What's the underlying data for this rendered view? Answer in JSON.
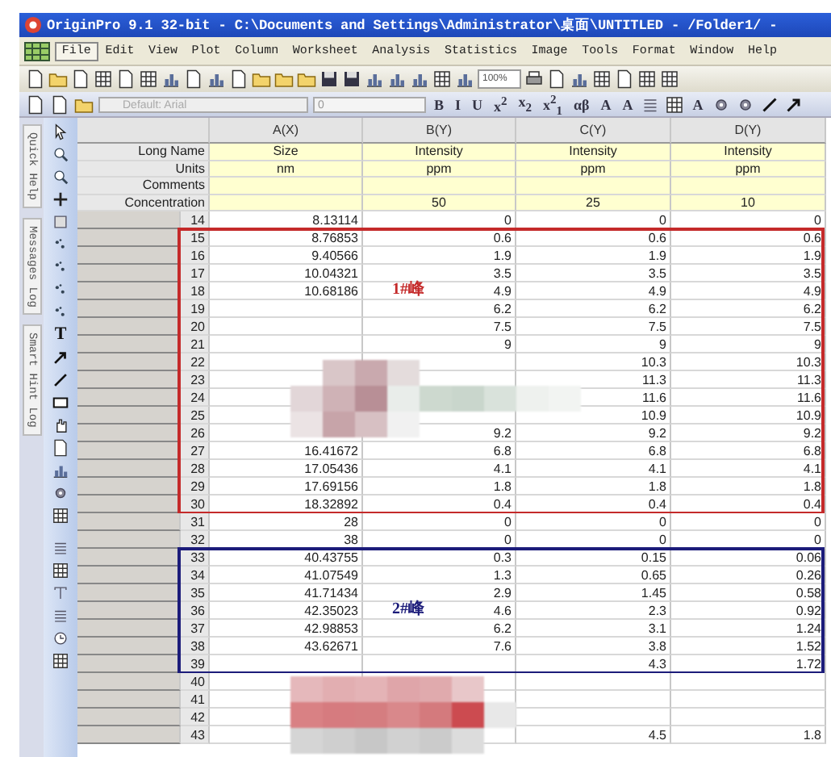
{
  "window": {
    "title": "OriginPro 9.1 32-bit - C:\\Documents and Settings\\Administrator\\桌面\\UNTITLED - /Folder1/ -"
  },
  "menu": [
    {
      "label": "File",
      "selected": true
    },
    {
      "label": "Edit",
      "selected": false
    },
    {
      "label": "View",
      "selected": false
    },
    {
      "label": "Plot",
      "selected": false
    },
    {
      "label": "Column",
      "selected": false
    },
    {
      "label": "Worksheet",
      "selected": false
    },
    {
      "label": "Analysis",
      "selected": false
    },
    {
      "label": "Statistics",
      "selected": false
    },
    {
      "label": "Image",
      "selected": false
    },
    {
      "label": "Tools",
      "selected": false
    },
    {
      "label": "Format",
      "selected": false
    },
    {
      "label": "Window",
      "selected": false
    },
    {
      "label": "Help",
      "selected": false
    }
  ],
  "toolbar": {
    "zoom_value": "100%"
  },
  "format_toolbar": {
    "font_value": "Default: Arial",
    "size_value": "0",
    "buttons": [
      "B",
      "I",
      "U",
      "x$^{2}$",
      "x$_{2}$",
      "x$^{2}$$_{1}$",
      "αβ",
      "A",
      "A"
    ],
    "color_button": "A"
  },
  "side_tabs": [
    "Quick Help",
    "Messages Log",
    "Smart Hint Log"
  ],
  "tools": {
    "text_tool": "T"
  },
  "sheet": {
    "columns": [
      "A(X)",
      "B(Y)",
      "C(Y)",
      "D(Y)"
    ],
    "meta_rows": [
      {
        "label": "Long Name",
        "cells": [
          "Size",
          "Intensity",
          "Intensity",
          "Intensity"
        ]
      },
      {
        "label": "Units",
        "cells": [
          "nm",
          "ppm",
          "ppm",
          "ppm"
        ]
      },
      {
        "label": "Comments",
        "cells": [
          null,
          null,
          null,
          null
        ]
      },
      {
        "label": "Concentration",
        "cells": [
          null,
          "50",
          "25",
          "10"
        ]
      }
    ],
    "row_blocks": [
      {
        "rows": [
          {
            "num": "14",
            "cells": [
              "8.13114",
              "0",
              "0",
              "0"
            ]
          }
        ]
      },
      {
        "label": "1#峰",
        "color": "#c42a2a",
        "rows": [
          {
            "num": "15",
            "cells": [
              "8.76853",
              "0.6",
              "0.6",
              "0.6"
            ]
          },
          {
            "num": "16",
            "cells": [
              "9.40566",
              "1.9",
              "1.9",
              "1.9"
            ]
          },
          {
            "num": "17",
            "cells": [
              "10.04321",
              "3.5",
              "3.5",
              "3.5"
            ]
          },
          {
            "num": "18",
            "cells": [
              "10.68186",
              "4.9",
              "4.9",
              "4.9"
            ]
          },
          {
            "num": "19",
            "cells": [
              null,
              "6.2",
              "6.2",
              "6.2"
            ]
          },
          {
            "num": "20",
            "cells": [
              null,
              "7.5",
              "7.5",
              "7.5"
            ]
          },
          {
            "num": "21",
            "cells": [
              null,
              "9",
              "9",
              "9"
            ]
          },
          {
            "num": "22",
            "cells": [
              null,
              null,
              "10.3",
              "10.3"
            ]
          },
          {
            "num": "23",
            "cells": [
              null,
              null,
              "11.3",
              "11.3"
            ]
          },
          {
            "num": "24",
            "cells": [
              null,
              null,
              "11.6",
              "11.6"
            ]
          },
          {
            "num": "25",
            "cells": [
              null,
              null,
              "10.9",
              "10.9"
            ]
          },
          {
            "num": "26",
            "cells": [
              null,
              "9.2",
              "9.2",
              "9.2"
            ]
          },
          {
            "num": "27",
            "cells": [
              "16.41672",
              "6.8",
              "6.8",
              "6.8"
            ]
          },
          {
            "num": "28",
            "cells": [
              "17.05436",
              "4.1",
              "4.1",
              "4.1"
            ]
          },
          {
            "num": "29",
            "cells": [
              "17.69156",
              "1.8",
              "1.8",
              "1.8"
            ]
          },
          {
            "num": "30",
            "cells": [
              "18.32892",
              "0.4",
              "0.4",
              "0.4"
            ]
          }
        ]
      },
      {
        "rows": [
          {
            "num": "31",
            "cells": [
              "28",
              "0",
              "0",
              "0"
            ]
          },
          {
            "num": "32",
            "cells": [
              "38",
              "0",
              "0",
              "0"
            ]
          }
        ]
      },
      {
        "label": "2#峰",
        "color": "#1c1c7a",
        "rows": [
          {
            "num": "33",
            "cells": [
              "40.43755",
              "0.3",
              "0.15",
              "0.06"
            ]
          },
          {
            "num": "34",
            "cells": [
              "41.07549",
              "1.3",
              "0.65",
              "0.26"
            ]
          },
          {
            "num": "35",
            "cells": [
              "41.71434",
              "2.9",
              "1.45",
              "0.58"
            ]
          },
          {
            "num": "36",
            "cells": [
              "42.35023",
              "4.6",
              "2.3",
              "0.92"
            ]
          },
          {
            "num": "37",
            "cells": [
              "42.98853",
              "6.2",
              "3.1",
              "1.24"
            ]
          },
          {
            "num": "38",
            "cells": [
              "43.62671",
              "7.6",
              "3.8",
              "1.52"
            ]
          },
          {
            "num": "39",
            "cells": [
              null,
              null,
              "4.3",
              "1.72"
            ]
          }
        ]
      },
      {
        "rows": [
          {
            "num": "40",
            "cells": [
              null,
              null,
              null,
              null
            ]
          },
          {
            "num": "41",
            "cells": [
              null,
              null,
              null,
              null
            ]
          },
          {
            "num": "42",
            "cells": [
              null,
              null,
              null,
              null
            ]
          },
          {
            "num": "43",
            "cells": [
              null,
              null,
              "4.5",
              "1.8"
            ]
          }
        ]
      }
    ]
  }
}
